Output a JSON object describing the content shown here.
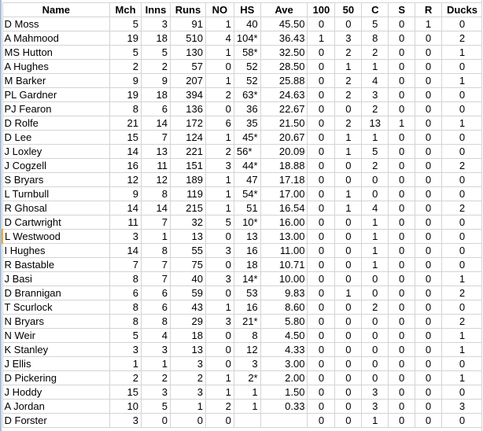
{
  "sheet": {
    "active_row_name": "L Westwood",
    "columns": [
      "Name",
      "Mch",
      "Inns",
      "Runs",
      "NO",
      "HS",
      "Ave",
      "100",
      "50",
      "C",
      "S",
      "R",
      "Ducks"
    ],
    "rows": [
      {
        "name": "D Moss",
        "mch": "5",
        "inns": "3",
        "runs": "91",
        "no": "1",
        "hs": "40",
        "ave": "45.50",
        "h100": "0",
        "h50": "0",
        "c": "5",
        "s": "0",
        "r": "1",
        "ducks": "0"
      },
      {
        "name": "A Mahmood",
        "mch": "19",
        "inns": "18",
        "runs": "510",
        "no": "4",
        "hs": "104*",
        "ave": "36.43",
        "h100": "1",
        "h50": "3",
        "c": "8",
        "s": "0",
        "r": "0",
        "ducks": "2"
      },
      {
        "name": "MS Hutton",
        "mch": "5",
        "inns": "5",
        "runs": "130",
        "no": "1",
        "hs": "58*",
        "ave": "32.50",
        "h100": "0",
        "h50": "2",
        "c": "2",
        "s": "0",
        "r": "0",
        "ducks": "1"
      },
      {
        "name": "A Hughes",
        "mch": "2",
        "inns": "2",
        "runs": "57",
        "no": "0",
        "hs": "52",
        "ave": "28.50",
        "h100": "0",
        "h50": "1",
        "c": "1",
        "s": "0",
        "r": "0",
        "ducks": "0"
      },
      {
        "name": "M Barker",
        "mch": "9",
        "inns": "9",
        "runs": "207",
        "no": "1",
        "hs": "52",
        "ave": "25.88",
        "h100": "0",
        "h50": "2",
        "c": "4",
        "s": "0",
        "r": "0",
        "ducks": "1"
      },
      {
        "name": "PL Gardner",
        "mch": "19",
        "inns": "18",
        "runs": "394",
        "no": "2",
        "hs": "63*",
        "ave": "24.63",
        "h100": "0",
        "h50": "2",
        "c": "3",
        "s": "0",
        "r": "0",
        "ducks": "0"
      },
      {
        "name": "PJ Fearon",
        "mch": "8",
        "inns": "6",
        "runs": "136",
        "no": "0",
        "hs": "36",
        "ave": "22.67",
        "h100": "0",
        "h50": "0",
        "c": "2",
        "s": "0",
        "r": "0",
        "ducks": "0"
      },
      {
        "name": "D Rolfe",
        "mch": "21",
        "inns": "14",
        "runs": "172",
        "no": "6",
        "hs": "35",
        "ave": "21.50",
        "h100": "0",
        "h50": "2",
        "c": "13",
        "s": "1",
        "r": "0",
        "ducks": "1"
      },
      {
        "name": "D Lee",
        "mch": "15",
        "inns": "7",
        "runs": "124",
        "no": "1",
        "hs": "45*",
        "ave": "20.67",
        "h100": "0",
        "h50": "1",
        "c": "1",
        "s": "0",
        "r": "0",
        "ducks": "0"
      },
      {
        "name": "J Loxley",
        "mch": "14",
        "inns": "13",
        "runs": "221",
        "no": "2",
        "hs": "56*",
        "hs_left": true,
        "ave": "20.09",
        "h100": "0",
        "h50": "1",
        "c": "5",
        "s": "0",
        "r": "0",
        "ducks": "0"
      },
      {
        "name": "J Cogzell",
        "mch": "16",
        "inns": "11",
        "runs": "151",
        "no": "3",
        "hs": "44*",
        "ave": "18.88",
        "h100": "0",
        "h50": "0",
        "c": "2",
        "s": "0",
        "r": "0",
        "ducks": "2"
      },
      {
        "name": "S Bryars",
        "mch": "12",
        "inns": "12",
        "runs": "189",
        "no": "1",
        "hs": "47",
        "ave": "17.18",
        "h100": "0",
        "h50": "0",
        "c": "0",
        "s": "0",
        "r": "0",
        "ducks": "0"
      },
      {
        "name": "L Turnbull",
        "mch": "9",
        "inns": "8",
        "runs": "119",
        "no": "1",
        "hs": "54*",
        "ave": "17.00",
        "h100": "0",
        "h50": "1",
        "c": "0",
        "s": "0",
        "r": "0",
        "ducks": "0"
      },
      {
        "name": "R Ghosal",
        "mch": "14",
        "inns": "14",
        "runs": "215",
        "no": "1",
        "hs": "51",
        "ave": "16.54",
        "h100": "0",
        "h50": "1",
        "c": "4",
        "s": "0",
        "r": "0",
        "ducks": "2"
      },
      {
        "name": "D Cartwright",
        "mch": "11",
        "inns": "7",
        "runs": "32",
        "no": "5",
        "hs": "10*",
        "ave": "16.00",
        "h100": "0",
        "h50": "0",
        "c": "1",
        "s": "0",
        "r": "0",
        "ducks": "0"
      },
      {
        "name": "L Westwood",
        "mch": "3",
        "inns": "1",
        "runs": "13",
        "no": "0",
        "hs": "13",
        "ave": "13.00",
        "h100": "0",
        "h50": "0",
        "c": "1",
        "s": "0",
        "r": "0",
        "ducks": "0"
      },
      {
        "name": "I Hughes",
        "mch": "14",
        "inns": "8",
        "runs": "55",
        "no": "3",
        "hs": "16",
        "ave": "11.00",
        "h100": "0",
        "h50": "0",
        "c": "1",
        "s": "0",
        "r": "0",
        "ducks": "0"
      },
      {
        "name": "R Bastable",
        "mch": "7",
        "inns": "7",
        "runs": "75",
        "no": "0",
        "hs": "18",
        "ave": "10.71",
        "h100": "0",
        "h50": "0",
        "c": "1",
        "s": "0",
        "r": "0",
        "ducks": "0"
      },
      {
        "name": "J Basi",
        "mch": "8",
        "inns": "7",
        "runs": "40",
        "no": "3",
        "hs": "14*",
        "ave": "10.00",
        "h100": "0",
        "h50": "0",
        "c": "0",
        "s": "0",
        "r": "0",
        "ducks": "1"
      },
      {
        "name": "D Brannigan",
        "mch": "6",
        "inns": "6",
        "runs": "59",
        "no": "0",
        "hs": "53",
        "ave": "9.83",
        "h100": "0",
        "h50": "1",
        "c": "0",
        "s": "0",
        "r": "0",
        "ducks": "2"
      },
      {
        "name": "T Scurlock",
        "mch": "8",
        "inns": "6",
        "runs": "43",
        "no": "1",
        "hs": "16",
        "ave": "8.60",
        "h100": "0",
        "h50": "0",
        "c": "2",
        "s": "0",
        "r": "0",
        "ducks": "0"
      },
      {
        "name": "N Bryars",
        "mch": "8",
        "inns": "8",
        "runs": "29",
        "no": "3",
        "hs": "21*",
        "ave": "5.80",
        "h100": "0",
        "h50": "0",
        "c": "0",
        "s": "0",
        "r": "0",
        "ducks": "2"
      },
      {
        "name": "N Weir",
        "mch": "5",
        "inns": "4",
        "runs": "18",
        "no": "0",
        "hs": "8",
        "ave": "4.50",
        "h100": "0",
        "h50": "0",
        "c": "0",
        "s": "0",
        "r": "0",
        "ducks": "1"
      },
      {
        "name": "K Stanley",
        "mch": "3",
        "inns": "3",
        "runs": "13",
        "no": "0",
        "hs": "12",
        "ave": "4.33",
        "h100": "0",
        "h50": "0",
        "c": "0",
        "s": "0",
        "r": "0",
        "ducks": "1"
      },
      {
        "name": "J Ellis",
        "mch": "1",
        "inns": "1",
        "runs": "3",
        "no": "0",
        "hs": "3",
        "ave": "3.00",
        "h100": "0",
        "h50": "0",
        "c": "0",
        "s": "0",
        "r": "0",
        "ducks": "0"
      },
      {
        "name": "D Pickering",
        "mch": "2",
        "inns": "2",
        "runs": "2",
        "no": "1",
        "hs": "2*",
        "ave": "2.00",
        "h100": "0",
        "h50": "0",
        "c": "0",
        "s": "0",
        "r": "0",
        "ducks": "1"
      },
      {
        "name": "J Hoddy",
        "mch": "15",
        "inns": "3",
        "runs": "3",
        "no": "1",
        "hs": "1",
        "ave": "1.50",
        "h100": "0",
        "h50": "0",
        "c": "3",
        "s": "0",
        "r": "0",
        "ducks": "0"
      },
      {
        "name": "A Jordan",
        "mch": "10",
        "inns": "5",
        "runs": "1",
        "no": "2",
        "hs": "1",
        "ave": "0.33",
        "h100": "0",
        "h50": "0",
        "c": "3",
        "s": "0",
        "r": "0",
        "ducks": "3"
      },
      {
        "name": "D Forster",
        "mch": "3",
        "inns": "0",
        "runs": "0",
        "no": "0",
        "hs": "",
        "ave": "",
        "h100": "0",
        "h50": "0",
        "c": "1",
        "s": "0",
        "r": "0",
        "ducks": "0"
      }
    ]
  }
}
